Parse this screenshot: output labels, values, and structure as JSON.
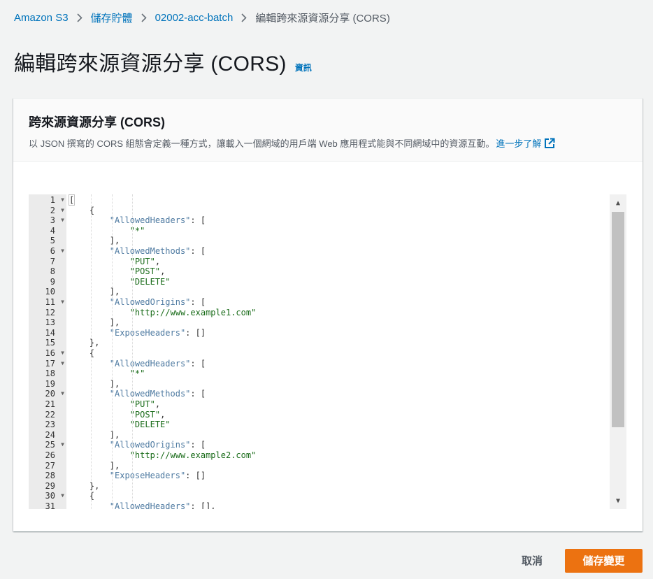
{
  "breadcrumb": [
    {
      "label": "Amazon S3"
    },
    {
      "label": "儲存貯體"
    },
    {
      "label": "02002-acc-batch"
    },
    {
      "label": "編輯跨來源資源分享 (CORS)"
    }
  ],
  "page": {
    "title": "編輯跨來源資源分享 (CORS)",
    "info_link": "資訊"
  },
  "panel": {
    "title": "跨來源資源分享 (CORS)",
    "description": "以 JSON 撰寫的 CORS 組態會定義一種方式，讓載入一個網域的用戶端 Web 應用程式能與不同網域中的資源互動。",
    "learn_more": "進一步了解"
  },
  "editor": {
    "lines": [
      "[",
      "    {",
      "        \"AllowedHeaders\": [",
      "            \"*\"",
      "        ],",
      "        \"AllowedMethods\": [",
      "            \"PUT\",",
      "            \"POST\",",
      "            \"DELETE\"",
      "        ],",
      "        \"AllowedOrigins\": [",
      "            \"http://www.example1.com\"",
      "        ],",
      "        \"ExposeHeaders\": []",
      "    },",
      "    {",
      "        \"AllowedHeaders\": [",
      "            \"*\"",
      "        ],",
      "        \"AllowedMethods\": [",
      "            \"PUT\",",
      "            \"POST\",",
      "            \"DELETE\"",
      "        ],",
      "        \"AllowedOrigins\": [",
      "            \"http://www.example2.com\"",
      "        ],",
      "        \"ExposeHeaders\": []",
      "    },",
      "    {",
      "        \"AllowedHeaders\": [],"
    ],
    "foldable_lines": [
      1,
      2,
      3,
      6,
      11,
      16,
      17,
      20,
      25,
      30
    ]
  },
  "actions": {
    "cancel_label": "取消",
    "save_label": "儲存變更"
  },
  "colors": {
    "link": "#0073bb",
    "primary_button": "#ec7211",
    "json_key": "#4e7aa1",
    "json_string": "#1a6c1a"
  }
}
